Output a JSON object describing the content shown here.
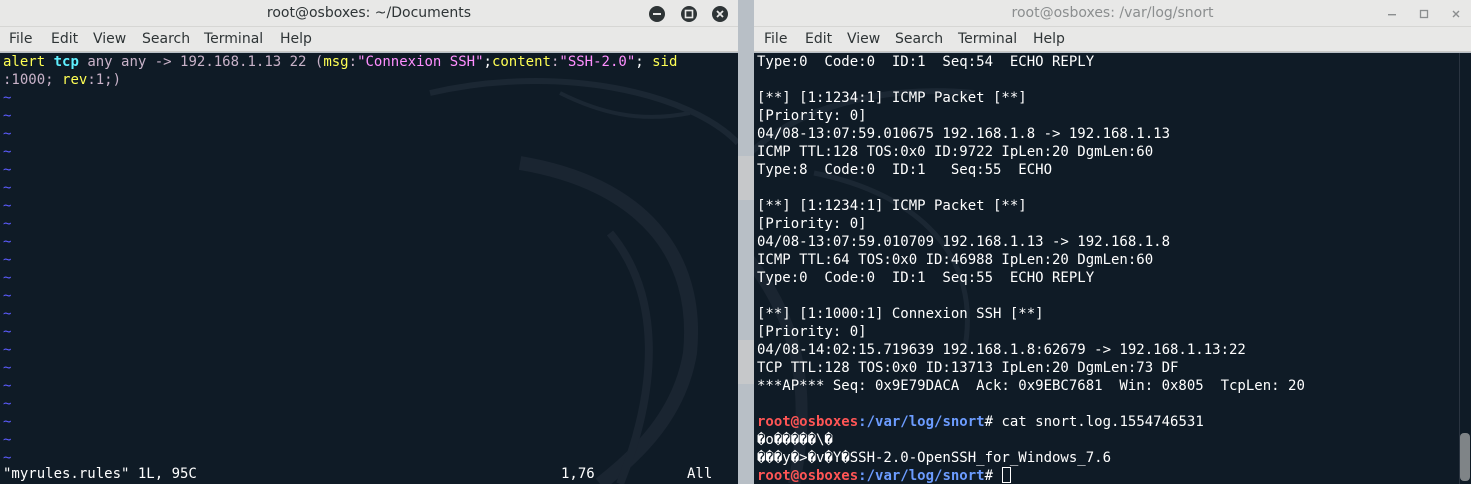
{
  "left": {
    "title": "root@osboxes: ~/Documents",
    "menu": [
      "File",
      "Edit",
      "View",
      "Search",
      "Terminal",
      "Help"
    ],
    "rule_line1": {
      "t1": "alert",
      "t2": " ",
      "t3": "tcp",
      "t4": " any any -> 192.168.1.13 22 (",
      "t5": "msg",
      "t6": ":",
      "t7": "\"Connexion SSH\"",
      "t8": ";",
      "t9": "content",
      "t10": ":",
      "t11": "\"SSH-2.0\"",
      "t12": "; ",
      "t13": "sid"
    },
    "rule_line2": {
      "t1": ":1000; ",
      "t2": "rev",
      "t3": ":1;)"
    },
    "tilde": "~",
    "status": {
      "file": "\"myrules.rules\" 1L, 95C",
      "pos": "1,76",
      "scroll": "All"
    }
  },
  "right": {
    "title": "root@osboxes: /var/log/snort",
    "menu": [
      "File",
      "Edit",
      "View",
      "Search",
      "Terminal",
      "Help"
    ],
    "lines": [
      "Type:0  Code:0  ID:1  Seq:54  ECHO REPLY",
      "",
      "[**] [1:1234:1] ICMP Packet [**]",
      "[Priority: 0]",
      "04/08-13:07:59.010675 192.168.1.8 -> 192.168.1.13",
      "ICMP TTL:128 TOS:0x0 ID:9722 IpLen:20 DgmLen:60",
      "Type:8  Code:0  ID:1   Seq:55  ECHO",
      "",
      "[**] [1:1234:1] ICMP Packet [**]",
      "[Priority: 0]",
      "04/08-13:07:59.010709 192.168.1.13 -> 192.168.1.8",
      "ICMP TTL:64 TOS:0x0 ID:46988 IpLen:20 DgmLen:60",
      "Type:0  Code:0  ID:1  Seq:55  ECHO REPLY",
      "",
      "[**] [1:1000:1] Connexion SSH [**]",
      "[Priority: 0]",
      "04/08-14:02:15.719639 192.168.1.8:62679 -> 192.168.1.13:22",
      "TCP TTL:128 TOS:0x0 ID:13713 IpLen:20 DgmLen:73 DF",
      "***AP*** Seq: 0x9E79DACA  Ack: 0x9EBC7681  Win: 0x805  TcpLen: 20",
      ""
    ],
    "prompt_user": "root@osboxes",
    "prompt_path": ":/var/log/snort",
    "prompt_suffix": "# ",
    "command": "cat snort.log.1554746531",
    "output": [
      "�o�����\\�",
      "���y�>�v�Y�SSH-2.0-OpenSSH_for_Windows_7.6"
    ]
  }
}
